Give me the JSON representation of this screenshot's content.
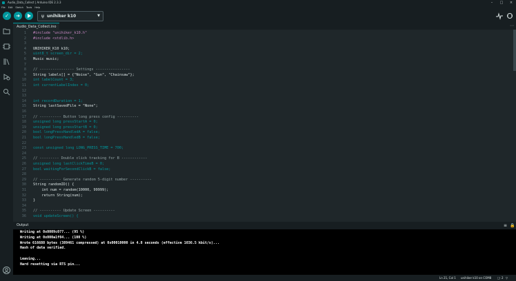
{
  "window": {
    "title": "Audio_Data_Collect | Arduino IDE 2.3.3",
    "controls": [
      "minimize-icon",
      "maximize-icon",
      "close-icon"
    ]
  },
  "menu": [
    "File",
    "Edit",
    "Sketch",
    "Tools",
    "Help"
  ],
  "toolbar": {
    "board_name": "unihiker k10",
    "buttons": [
      "verify-icon",
      "upload-icon",
      "debug-icon"
    ],
    "right_icons": [
      "serial-plotter-icon",
      "serial-monitor-icon"
    ]
  },
  "sidebar": {
    "icons": [
      "sketchbook-icon",
      "boards-manager-icon",
      "library-manager-icon",
      "debug-icon",
      "search-icon"
    ],
    "bottom_icon": "profile-icon"
  },
  "tab": {
    "label": "Audio_Data_Collect.ino",
    "more": "⋯"
  },
  "editor": {
    "lines": [
      {
        "n": "1",
        "t": "#include \"unihiker_k10.h\""
      },
      {
        "n": "2",
        "t": "#include <stdlib.h>"
      },
      {
        "n": "3",
        "t": ""
      },
      {
        "n": "4",
        "t": "UNIHIKER_K10 k10;"
      },
      {
        "n": "5",
        "t": "uint8_t screen_dir = 2;"
      },
      {
        "n": "6",
        "t": "Music music;"
      },
      {
        "n": "7",
        "t": ""
      },
      {
        "n": "8",
        "t": "// ---------------- Settings ----------------"
      },
      {
        "n": "9",
        "t": "String labels[] = {\"Noise\", \"Gun\", \"Chainsaw\"};"
      },
      {
        "n": "10",
        "t": "int labelCount = 3;"
      },
      {
        "n": "11",
        "t": "int currentLabelIndex = 0;"
      },
      {
        "n": "12",
        "t": ""
      },
      {
        "n": "13",
        "t": ""
      },
      {
        "n": "14",
        "t": "int recordDuration = 1;"
      },
      {
        "n": "15",
        "t": "String lastSavedFile = \"None\";"
      },
      {
        "n": "16",
        "t": ""
      },
      {
        "n": "17",
        "t": "// ---------- Button long press config ----------"
      },
      {
        "n": "18",
        "t": "unsigned long pressStartA = 0;"
      },
      {
        "n": "19",
        "t": "unsigned long pressStartB = 0;"
      },
      {
        "n": "20",
        "t": "bool longPressHandledA = false;"
      },
      {
        "n": "21",
        "t": "bool longPressHandledB = false;"
      },
      {
        "n": "22",
        "t": ""
      },
      {
        "n": "23",
        "t": "const unsigned long LONG_PRESS_TIME = 700;"
      },
      {
        "n": "24",
        "t": ""
      },
      {
        "n": "25",
        "t": "// --------- Double click tracking for B ------------"
      },
      {
        "n": "26",
        "t": "unsigned long lastClickTimeB = 0;"
      },
      {
        "n": "27",
        "t": "bool waitingForSecondClickB = false;"
      },
      {
        "n": "28",
        "t": ""
      },
      {
        "n": "29",
        "t": "// ---------- Generate random 5-digit number ----------"
      },
      {
        "n": "30",
        "t": "String randomID() {"
      },
      {
        "n": "31",
        "t": "    int num = random(10000, 99999);"
      },
      {
        "n": "32",
        "t": "    return String(num);"
      },
      {
        "n": "33",
        "t": "}"
      },
      {
        "n": "34",
        "t": ""
      },
      {
        "n": "35",
        "t": "// ---------- Update Screen ----------"
      },
      {
        "n": "36",
        "t": "void updateScreen() {"
      }
    ]
  },
  "output": {
    "label": "Output",
    "lines": [
      "Writing at 0x0009c077... (95 %)",
      "Writing at 0x000a1f04... (100 %)",
      "Wrote 616688 bytes (389461 compressed) at 0x00010000 in 4.8 seconds (effective 1036.5 kbit/s)...",
      "Hash of data verified.",
      "",
      "Leaving...",
      "Hard resetting via RTS pin..."
    ]
  },
  "status": {
    "position": "Ln 21, Col 1",
    "board_port": "unihiker k10 on COM8",
    "notifications": "2"
  },
  "colors": {
    "accent": "#00979d",
    "keyword": "#00979d",
    "comment": "#95a5a6",
    "string": "#7fcbcd",
    "function": "#f39c12",
    "preprocessor": "#c586c0"
  }
}
